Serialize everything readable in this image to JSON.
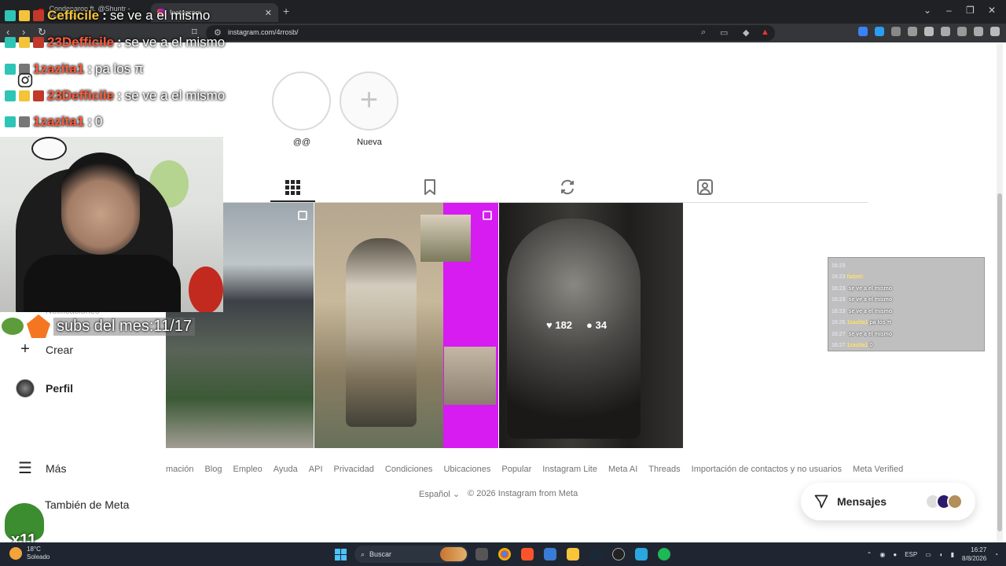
{
  "browser": {
    "tabs": [
      {
        "label": "Condenaron ft. @Shuntr - YouTube"
      },
      {
        "label": "Instagram"
      }
    ],
    "url": "instagram.com/4rrosb/"
  },
  "stories": [
    {
      "label": "@@"
    },
    {
      "label": "Nueva"
    }
  ],
  "posts": [
    {
      "likes": "",
      "comments": ""
    },
    {
      "likes": "",
      "comments": ""
    },
    {
      "likes": "182",
      "comments": "34"
    }
  ],
  "nav": {
    "crear": "Crear",
    "perfil": "Perfil",
    "mas": "Más",
    "meta": "También de Meta",
    "notif_ghost": "Notificaciones"
  },
  "footer": {
    "links": [
      "mación",
      "Blog",
      "Empleo",
      "Ayuda",
      "API",
      "Privacidad",
      "Condiciones",
      "Ubicaciones",
      "Popular",
      "Instagram Lite",
      "Meta AI",
      "Threads",
      "Importación de contactos y no usuarios",
      "Meta Verified"
    ],
    "language": "Español",
    "copyright": "© 2026 Instagram from Meta"
  },
  "messages_button": "Mensajes",
  "stream": {
    "chat": [
      {
        "user": "Cefficile",
        "text": "se ve a el mismo",
        "gold": true
      },
      {
        "user": "23Defficile",
        "text": "se ve a el mismo",
        "gold": false
      },
      {
        "user": "1zazita1",
        "text": "pa los π",
        "gold": false
      },
      {
        "user": "23Defficile",
        "text": "se ve a el mismo",
        "gold": false
      },
      {
        "user": "1zazita1",
        "text": "0",
        "gold": false
      }
    ],
    "subs_text": "subs del mes:11/17",
    "frog_label": "x11",
    "chatbox": [
      {
        "time": "16:23",
        "user": "",
        "text": ""
      },
      {
        "time": "16:23",
        "user": "Ilatzel:",
        "text": ""
      },
      {
        "time": "16:23",
        "user": "",
        "text": "se ve a el mismo"
      },
      {
        "time": "16:23",
        "user": "",
        "text": "se ve a el mismo"
      },
      {
        "time": "16:23",
        "user": "",
        "text": "se ve a el mismo"
      },
      {
        "time": "16:26",
        "user": "1zazita1",
        "text": "pa los π"
      },
      {
        "time": "16:27",
        "user": "",
        "text": "se ve a el mismo"
      },
      {
        "time": "16:27",
        "user": "1zazita1",
        "text": "0"
      }
    ]
  },
  "taskbar": {
    "temp": "18°C",
    "weather": "Soleado",
    "search": "Buscar",
    "lang": "ESP",
    "time": "16:27",
    "date": "8/8/2026"
  },
  "colors": {
    "magenta": "#d61cf0",
    "chat_user": "#ff5a3c",
    "accent": "#4cc2ff"
  }
}
